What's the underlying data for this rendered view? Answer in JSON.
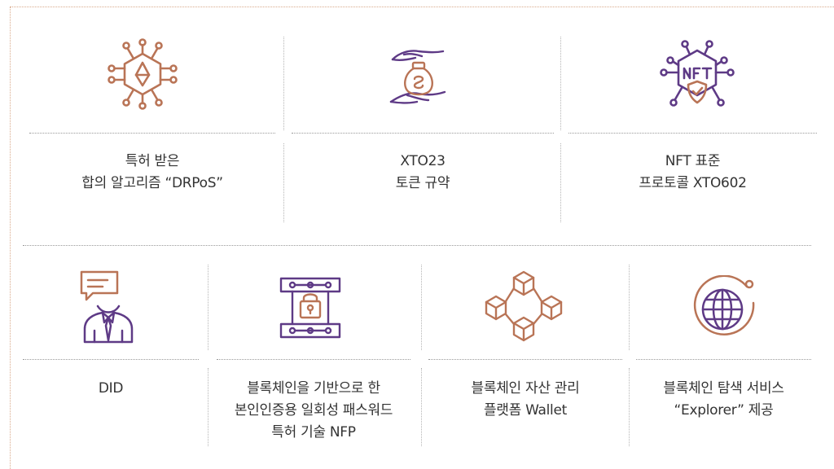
{
  "colors": {
    "brown": "#b97456",
    "purple": "#5e3a86",
    "frame": "#d9a98a",
    "text": "#333333"
  },
  "features": [
    {
      "icon": "blockchain-hexagon-icon",
      "lines": [
        "특허 받은",
        "합의 알고리즘 “DRPoS”"
      ]
    },
    {
      "icon": "money-bag-hands-icon",
      "lines": [
        "XTO23",
        "토큰 규약"
      ]
    },
    {
      "icon": "nft-shield-icon",
      "lines": [
        "NFT 표준",
        "프로토콜 XTO602"
      ]
    },
    {
      "icon": "identity-person-chat-icon",
      "lines": [
        "DID"
      ]
    },
    {
      "icon": "secure-lock-server-icon",
      "lines": [
        "블록체인을 기반으로 한",
        "본인인증용 일회성 패스워드",
        "특허 기술 NFP"
      ]
    },
    {
      "icon": "blockchain-cubes-icon",
      "lines": [
        "블록체인 자산 관리",
        "플랫폼 Wallet"
      ]
    },
    {
      "icon": "globe-explorer-icon",
      "lines": [
        "블록체인 탐색 서비스",
        "“Explorer” 제공"
      ]
    }
  ]
}
